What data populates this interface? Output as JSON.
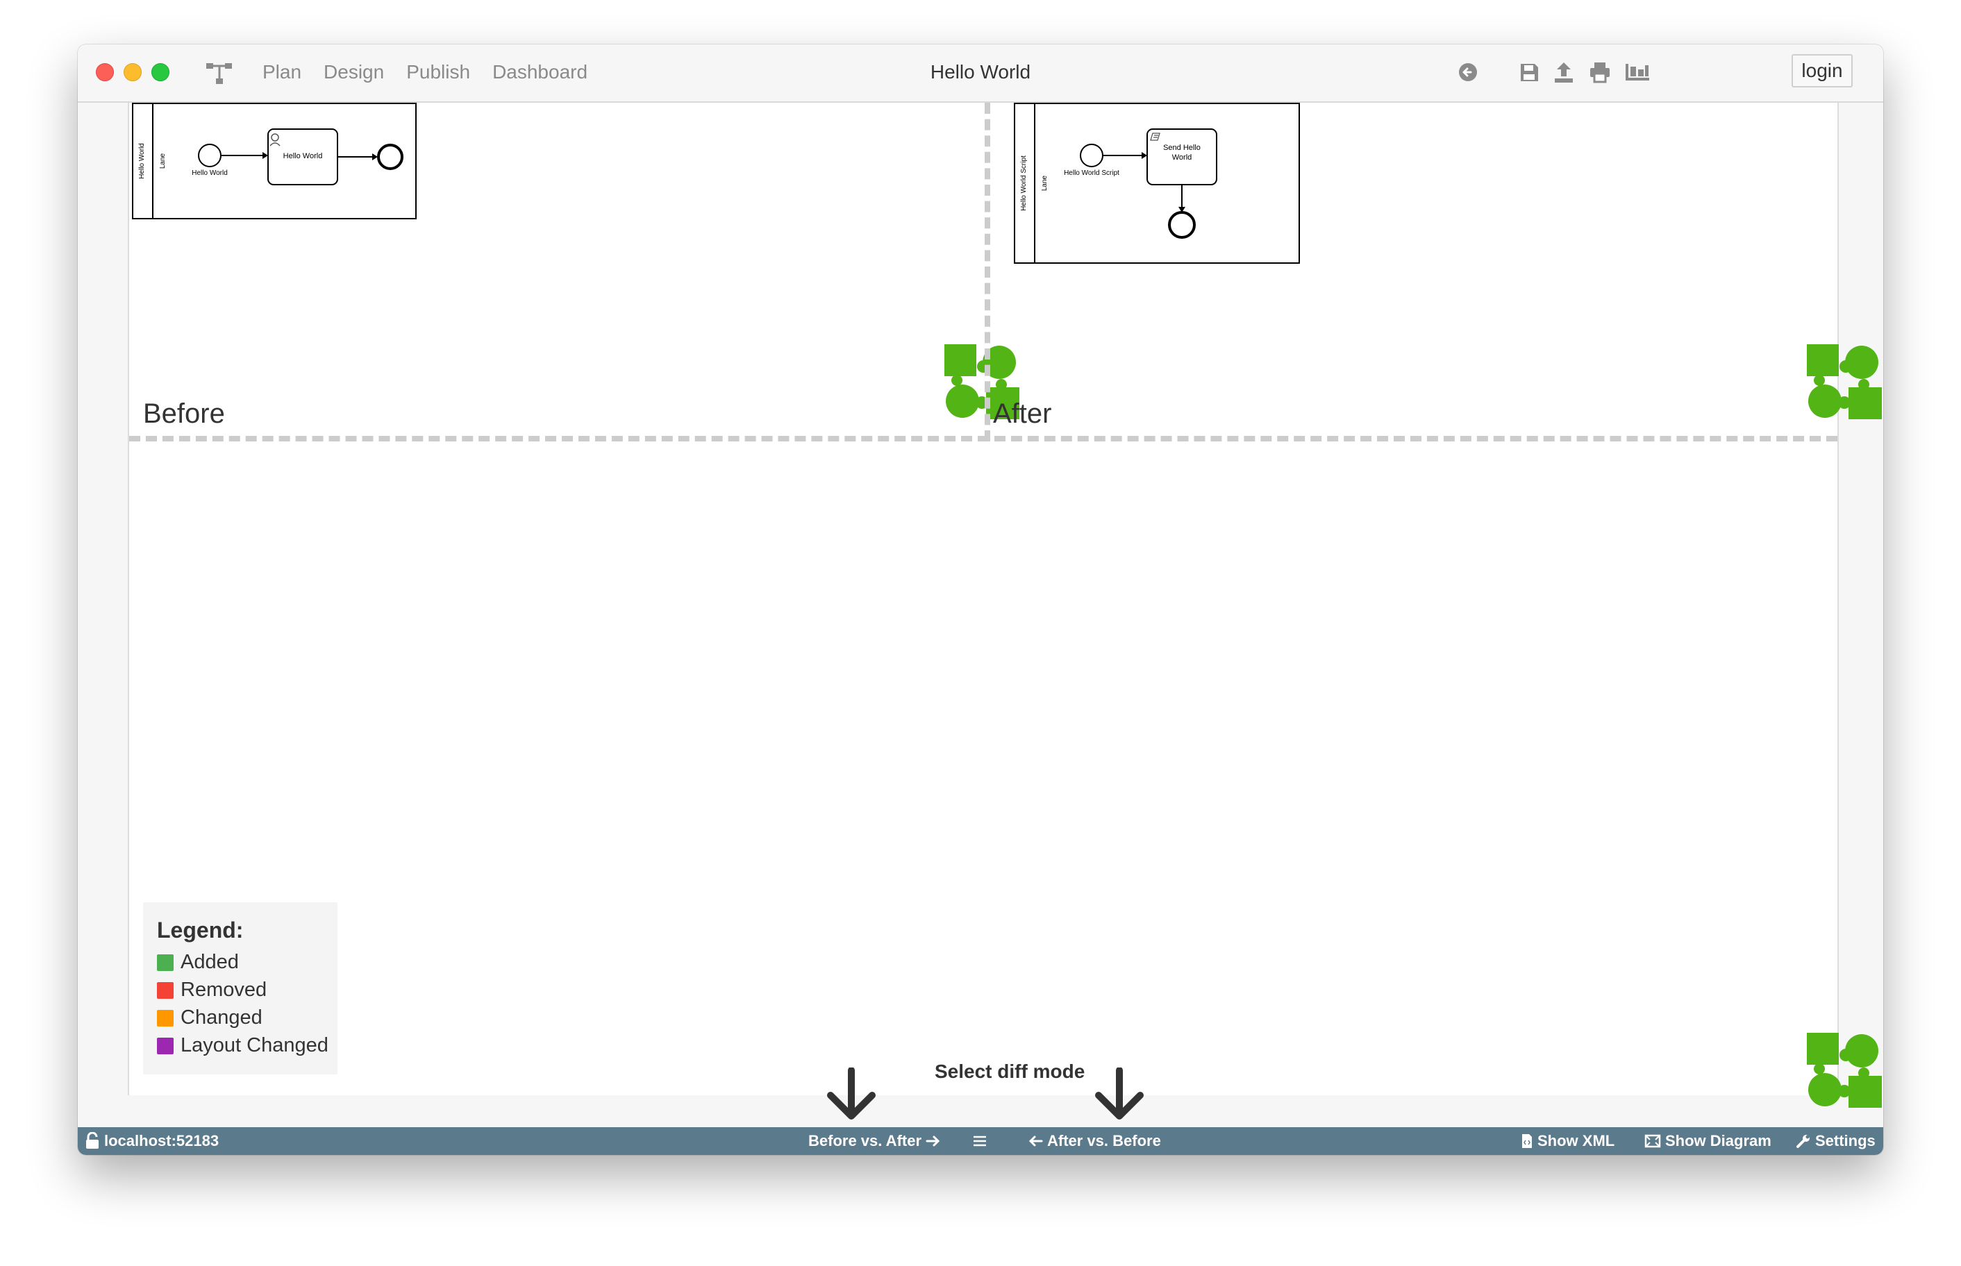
{
  "window": {
    "title": "Hello World",
    "nav": [
      "Plan",
      "Design",
      "Publish",
      "Dashboard"
    ],
    "login_label": "login",
    "toolbar_icons": [
      "back-icon",
      "save-icon",
      "upload-icon",
      "print-icon",
      "deploy-icon"
    ]
  },
  "panes": {
    "before_label": "Before",
    "after_label": "After"
  },
  "before_diagram": {
    "pool": "Hello World",
    "lane": "Lane",
    "task": "Hello World",
    "start_label": "Hello World"
  },
  "after_diagram": {
    "pool": "Hello World Script",
    "lane": "Lane",
    "task_line1": "Send Hello",
    "task_line2": "World",
    "start_label": "Hello World Script"
  },
  "legend": {
    "title": "Legend:",
    "items": [
      {
        "label": "Added",
        "color": "#4caf50"
      },
      {
        "label": "Removed",
        "color": "#f44336"
      },
      {
        "label": "Changed",
        "color": "#ff9800"
      },
      {
        "label": "Layout Changed",
        "color": "#9c27b0"
      }
    ]
  },
  "diff": {
    "title": "Select diff mode"
  },
  "statusbar": {
    "host": "localhost:52183",
    "before_vs_after": "Before vs. After",
    "after_vs_before": "After vs. Before",
    "show_xml": "Show XML",
    "show_diagram": "Show Diagram",
    "settings": "Settings"
  },
  "colors": {
    "logo_green": "#52b415",
    "statusbar": "#5b7a8c"
  }
}
